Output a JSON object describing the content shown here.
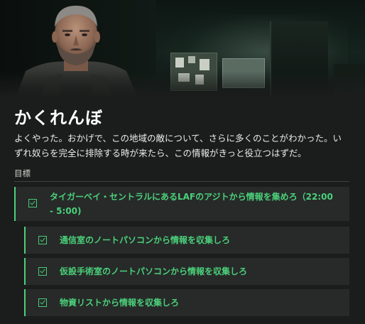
{
  "mission": {
    "title": "かくれんぼ",
    "description": "よくやった。おかげで、この地域の敵について、さらに多くのことがわかった。いずれ奴らを完全に排除する時が来たら、この情報がきっと役立つはずだ。"
  },
  "objectives": {
    "label": "目標",
    "main": {
      "text": "タイガーベイ・セントラルにあるLAFのアジトから情報を集めろ（22:00 - 5:00)",
      "completed": true
    },
    "sub": [
      {
        "text": "通信室のノートパソコンから情報を収集しろ",
        "completed": true
      },
      {
        "text": "仮設手術室のノートパソコンから情報を収集しろ",
        "completed": true
      },
      {
        "text": "物資リストから情報を収集しろ",
        "completed": true
      }
    ]
  },
  "colors": {
    "accent": "#4bd07a",
    "panel": "#272a29",
    "background": "#1b1d1c"
  },
  "icons": {
    "objective_status": "checkbox-checked-icon"
  }
}
